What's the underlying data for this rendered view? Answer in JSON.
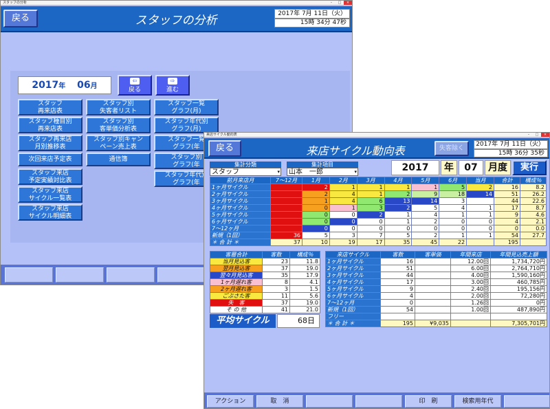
{
  "w1": {
    "titlebar": "スタッフの分析",
    "title": "スタッフの分析",
    "back": "戻る",
    "date": "2017年 7月 11日（火）",
    "time": "15時 34分 47秒",
    "year": "2017",
    "year_suffix": "年",
    "month": "06",
    "month_suffix": "月",
    "prev": "戻る",
    "next": "進む",
    "buttons": [
      "スタッフ\n再来店表",
      "スタッフ種目別\n再来店表",
      "スタッフ再来店\n月別推移表",
      "次回来店予定表",
      "スタッフ来店\n予定実績対比表",
      "スタッフ来店\nサイクル一覧表",
      "スタッフ来店\nサイクル明細表",
      "スタッフ別\n失客者リスト",
      "スタッフ別\n客単価分析表",
      "スタッフ別キャン\nペーン売上表",
      "通信簿",
      "スタッフ一覧\nグラフ(月)",
      "スタッフ年代別\nグラフ(月)",
      "スタッフ一覧\nグラフ(年",
      "スタッフ別\nグラフ(年",
      "スタッフ年代別\nグラフ(年"
    ]
  },
  "w2": {
    "titlebar": "来店サイクル動向表",
    "title": "来店サイクル動向表",
    "back": "戻る",
    "lost": "失客除く",
    "date": "2017年 7月 11日（火）",
    "time": "15時 36分 35秒",
    "cat_label": "集計分類",
    "cat_value": "スタッフ",
    "item_label": "集計項目",
    "item_value": "山本　一郎",
    "year": "2017",
    "year_u": "年",
    "month": "07",
    "month_u": "月度",
    "run": "実行",
    "t1_headers": [
      "前月来店月",
      "7〜12月",
      "1月",
      "2月",
      "3月",
      "4月",
      "5月",
      "6月",
      "当月",
      "合計",
      "構成％"
    ],
    "t1_rows": [
      [
        "1ヶ月サイクル",
        "",
        "2",
        "1",
        "1",
        "1",
        "1",
        "5",
        "2",
        "16",
        "8.2"
      ],
      [
        "2ヶ月サイクル",
        "",
        "2",
        "4",
        "1",
        "2",
        "9",
        "18",
        "14",
        "51",
        "26.2"
      ],
      [
        "3ヶ月サイクル",
        "",
        "1",
        "4",
        "6",
        "13",
        "14",
        "3",
        "",
        "44",
        "22.6"
      ],
      [
        "4ヶ月サイクル",
        "",
        "0",
        "1",
        "3",
        "2",
        "5",
        "4",
        "1",
        "17",
        "8.7"
      ],
      [
        "5ヶ月サイクル",
        "",
        "0",
        "0",
        "2",
        "1",
        "4",
        "1",
        "1",
        "9",
        "4.6"
      ],
      [
        "6ヶ月サイクル",
        "",
        "0",
        "0",
        "0",
        "1",
        "2",
        "0",
        "0",
        "4",
        "2.1"
      ],
      [
        "7〜12ヶ月",
        "",
        "0",
        "0",
        "0",
        "0",
        "0",
        "0",
        "0",
        "0",
        "0.0"
      ],
      [
        "新規（1回）",
        "36",
        "5",
        "3",
        "7",
        "5",
        "2",
        "1",
        "1",
        "54",
        "27.7"
      ]
    ],
    "t1_total": [
      "＊ 合 計 ＊",
      "37",
      "10",
      "19",
      "17",
      "35",
      "45",
      "22",
      "",
      "195",
      ""
    ],
    "t2_headers": [
      "客層合計",
      "客数",
      "構成％"
    ],
    "t2_rows": [
      [
        "当月見込客",
        "23",
        "11.8"
      ],
      [
        "翌月見込客",
        "37",
        "19.0"
      ],
      [
        "翌々月見込客",
        "35",
        "17.9"
      ],
      [
        "1ヶ月遅れ客",
        "8",
        "4.1"
      ],
      [
        "2ヶ月遅れ客",
        "3",
        "1.5"
      ],
      [
        "ごぶさた客",
        "11",
        "5.6"
      ],
      [
        "失　客",
        "37",
        "19.0"
      ],
      [
        "そ の 他",
        "41",
        "21.0"
      ]
    ],
    "avg_label": "平均サイクル",
    "avg_value": "68日",
    "t3_headers": [
      "来店サイクル",
      "客数",
      "客単価",
      "年間来店",
      "年間見込売上額"
    ],
    "t3_rows": [
      [
        "1ヶ月サイクル",
        "16",
        "",
        "12.00回",
        "1,734,720円"
      ],
      [
        "2ヶ月サイクル",
        "51",
        "",
        "6.00回",
        "2,764,710円"
      ],
      [
        "3ヶ月サイクル",
        "44",
        "",
        "4.00回",
        "1,590,160円"
      ],
      [
        "4ヶ月サイクル",
        "17",
        "",
        "3.00回",
        "460,785円"
      ],
      [
        "5ヶ月サイクル",
        "9",
        "",
        "2.40回",
        "195,156円"
      ],
      [
        "6ヶ月サイクル",
        "4",
        "",
        "2.00回",
        "72,280円"
      ],
      [
        "7〜12ヶ月",
        "0",
        "",
        "1.26回",
        "0円"
      ],
      [
        "新規（1回）",
        "54",
        "",
        "1.00回",
        "487,890円"
      ],
      [
        "フリー",
        "",
        "",
        "",
        ""
      ]
    ],
    "t3_total": [
      "＊ 合 計 ＊",
      "195",
      "¥9,035",
      "",
      "7,305,701円"
    ],
    "footer": [
      "アクション",
      "取　消",
      "",
      "",
      "印　刷",
      "検索用年代",
      ""
    ]
  },
  "colors": {
    "red": "#e01010",
    "orange": "#f7a020",
    "yellow": "#f8e840",
    "green": "#90e870",
    "pink": "#f8c0d0",
    "blue": "#2848c8",
    "lime": "#c8f0a0"
  }
}
